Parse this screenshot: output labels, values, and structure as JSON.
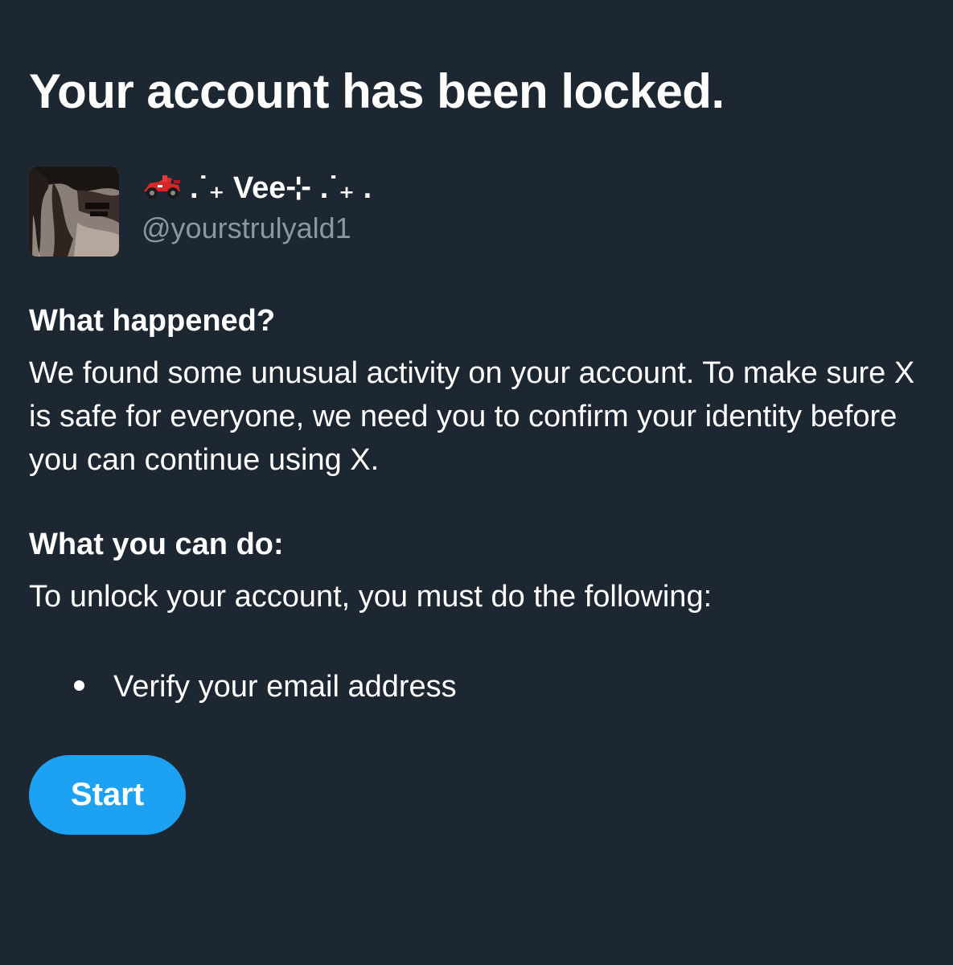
{
  "page": {
    "title": "Your account has been locked."
  },
  "account": {
    "display_name": ".˙₊ Vee⊹ .˙₊ .",
    "name_emoji": "racing-car-icon",
    "handle": "@yourstrulyald1"
  },
  "what_happened": {
    "heading": "What happened?",
    "text": "We found some unusual activity on your account. To make sure X is safe for everyone, we need you to confirm your identity before you can continue using X."
  },
  "what_you_can_do": {
    "heading": "What you can do:",
    "text": "To unlock your account, you must do the following:",
    "steps": [
      "Verify your email address"
    ]
  },
  "actions": {
    "start_label": "Start"
  },
  "colors": {
    "background": "#1c2732",
    "text_primary": "#ffffff",
    "text_secondary": "#8899a6",
    "accent": "#1da1f2"
  }
}
